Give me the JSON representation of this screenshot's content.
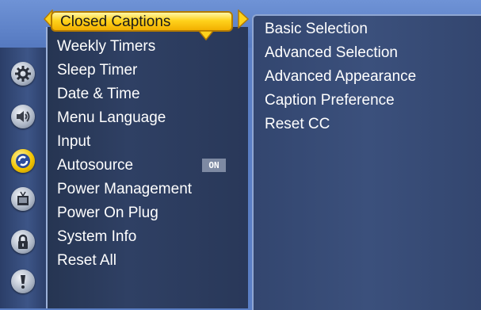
{
  "menu": {
    "selected_label": "Closed Captions",
    "items": [
      "Weekly Timers",
      "Sleep Timer",
      "Date & Time",
      "Menu Language",
      "Input",
      "Autosource",
      "Power Management",
      "Power On Plug",
      "System Info",
      "Reset All"
    ],
    "autosource_badge": "ON"
  },
  "submenu": {
    "items": [
      "Basic Selection",
      "Advanced Selection",
      "Advanced Appearance",
      "Caption Preference",
      "Reset CC"
    ]
  },
  "rail_icons": [
    {
      "name": "gear-icon",
      "active": false
    },
    {
      "name": "speaker-icon",
      "active": false
    },
    {
      "name": "setup-icon",
      "active": true
    },
    {
      "name": "tv-icon",
      "active": false
    },
    {
      "name": "lock-icon",
      "active": false
    },
    {
      "name": "info-icon",
      "active": false
    }
  ],
  "colors": {
    "highlight": "#ffd21c",
    "panel": "#2f4064",
    "background": "#5a7ec4"
  }
}
